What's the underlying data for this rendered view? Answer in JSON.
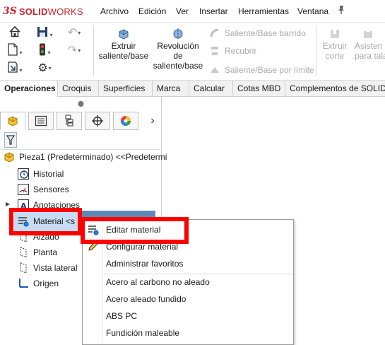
{
  "app": {
    "logo_ds": "3S",
    "brand_solid": "SOLID",
    "brand_works": "WORKS"
  },
  "menubar": {
    "items": [
      "Archivo",
      "Edición",
      "Ver",
      "Insertar",
      "Herramientas",
      "Ventana"
    ]
  },
  "command_manager": {
    "extruir_saliente": "Extruir saliente/base",
    "revolucion_saliente": "Revolución de saliente/base",
    "saliente_barrido": "Saliente/Base barrido",
    "recubrir": "Recubrir",
    "saliente_limite": "Saliente/Base por límite",
    "extruir_corte": "Extruir corte",
    "asistente": "Asisten para tala"
  },
  "tabs": [
    "Operaciones",
    "Croquis",
    "Superficies",
    "Marca",
    "Calcular",
    "Cotas MBD",
    "Complementos de SOLID"
  ],
  "tabs_active": "Operaciones",
  "feature_tree": {
    "root": "Pieza1 (Predeterminado) <<Predetermi",
    "items": [
      "Historial",
      "Sensores",
      "Anotaciones",
      "Material <s",
      "Alzado",
      "Planta",
      "Vista lateral",
      "Origen"
    ]
  },
  "context_menu": {
    "items": [
      "Editar material",
      "Configurar material",
      "Administrar favoritos",
      "Acero al carbono no aleado",
      "Acero aleado fundido",
      "ABS PC",
      "Fundición maleable"
    ]
  },
  "colors": {
    "brand": "#d22630",
    "highlight_box": "#ff0000",
    "selection": "#c7dcf3"
  }
}
